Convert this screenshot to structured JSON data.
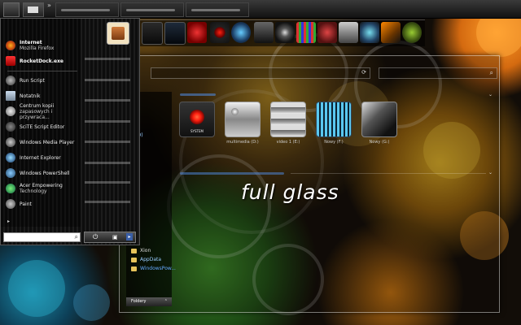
{
  "start_menu": {
    "items": [
      {
        "label": "Internet",
        "sub": "Mozilla Firefox",
        "icon": "firefox-icon"
      },
      {
        "label": "RocketDock.exe",
        "sub": "",
        "icon": "rocketdock-icon"
      },
      {
        "label": "Run Script",
        "sub": "",
        "icon": "script-icon"
      },
      {
        "label": "Notatnik",
        "sub": "",
        "icon": "notepad-icon"
      },
      {
        "label": "Centrum kopii",
        "sub": "zapasowych i przywraca...",
        "icon": "backup-icon"
      },
      {
        "label": "SciTE Script Editor",
        "sub": "",
        "icon": "editor-icon"
      },
      {
        "label": "Windows Media Player",
        "sub": "",
        "icon": "media-player-icon"
      },
      {
        "label": "Internet Explorer",
        "sub": "",
        "icon": "ie-icon"
      },
      {
        "label": "Windows PowerShell",
        "sub": "",
        "icon": "powershell-icon"
      },
      {
        "label": "Acer Empowering",
        "sub": "Technology",
        "icon": "acer-icon"
      },
      {
        "label": "Paint",
        "sub": "",
        "icon": "paint-icon"
      }
    ]
  },
  "explorer": {
    "nav_fragments": [
      "ty",
      "ia (D)",
      "files",
      "ck"
    ],
    "folders": [
      "Xion",
      "AppData",
      "WindowsPow..."
    ],
    "nav_footer": "Foldery",
    "items": [
      {
        "label": "SYSTEM",
        "caption": "",
        "icon": "hal-eye-icon"
      },
      {
        "label": "",
        "caption": "multimedia (D:)",
        "icon": "drive-icon"
      },
      {
        "label": "",
        "caption": "video 1 (E:)",
        "icon": "drive-chrome-icon"
      },
      {
        "label": "",
        "caption": "Nowy (F:)",
        "icon": "equalizer-drive-icon"
      },
      {
        "label": "",
        "caption": "Nowy (G:)",
        "icon": "turntable-drive-icon"
      }
    ]
  },
  "brand_text": "full glass",
  "colors": {
    "accent_blue": "#4a90e8",
    "folder_yellow": "#e7c35a",
    "red_light": "#ff2010"
  }
}
